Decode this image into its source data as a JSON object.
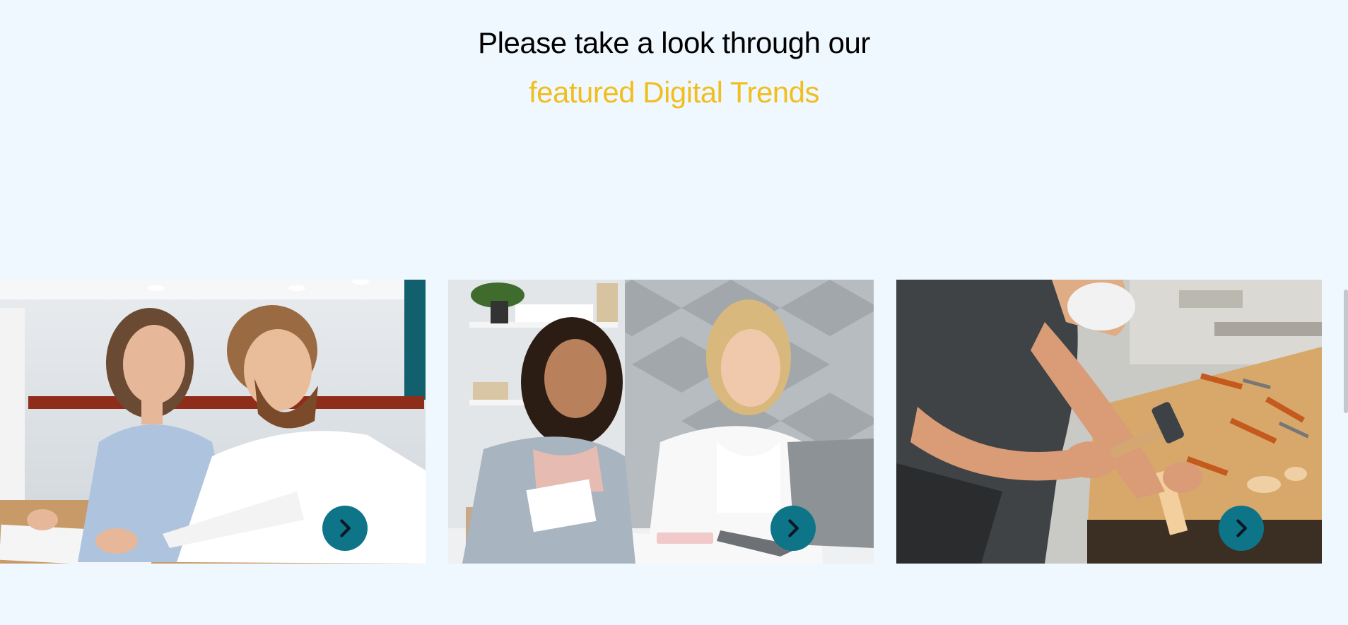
{
  "heading": {
    "line1": "Please take a look through our",
    "line2": "featured Digital Trends"
  },
  "colors": {
    "background": "#f0f8ff",
    "accent_yellow": "#f0be1e",
    "button_teal": "#0e7488"
  },
  "cards": [
    {
      "image_subject": "Two colleagues at an office desk, woman smiling while man writes",
      "button_icon": "chevron-right-icon"
    },
    {
      "image_subject": "Two women working together at a table with a laptop and notepad",
      "button_icon": "chevron-right-icon"
    },
    {
      "image_subject": "Carpenter wearing a dust mask hammering wood at a workbench",
      "button_icon": "chevron-right-icon"
    }
  ]
}
